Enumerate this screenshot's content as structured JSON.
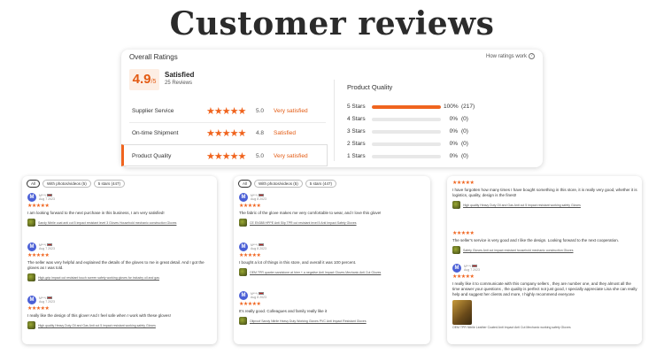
{
  "page_title": "Customer reviews",
  "ratings": {
    "title": "Overall Ratings",
    "how_link": "How ratings work",
    "score": "4.9",
    "score_denominator": "/5",
    "score_word": "Satisfied",
    "review_count": "25 Reviews",
    "subratings": [
      {
        "label": "Supplier Service",
        "score": "5.0",
        "verdict": "Very satisfied",
        "stars": "★★★★★"
      },
      {
        "label": "On-time Shipment",
        "score": "4.8",
        "verdict": "Satisfied",
        "stars": "★★★★★"
      },
      {
        "label": "Product Quality",
        "score": "5.0",
        "verdict": "Very satisfied",
        "stars": "★★★★★"
      }
    ],
    "product_quality_title": "Product Quality",
    "distribution": [
      {
        "label": "5 Stars",
        "percent": 100,
        "percent_label": "100%",
        "count": "(217)"
      },
      {
        "label": "4 Stars",
        "percent": 0,
        "percent_label": "0%",
        "count": "(0)"
      },
      {
        "label": "3 Stars",
        "percent": 0,
        "percent_label": "0%",
        "count": "(0)"
      },
      {
        "label": "2 Stars",
        "percent": 0,
        "percent_label": "0%",
        "count": "(0)"
      },
      {
        "label": "1 Stars",
        "percent": 0,
        "percent_label": "0%",
        "count": "(0)"
      }
    ],
    "accent_color": "#f0641e"
  },
  "panels": [
    {
      "filters": [
        "All",
        "With photos/videos (5)",
        "5 stars (447)"
      ],
      "reviews": [
        {
          "avatar": "M",
          "name": "M***i",
          "date": "Aug 7 2023",
          "stars": "★★★★★",
          "text": "I am looking forward to the next purchase in this business, I am very satisfied!",
          "product": "Sandy Nitrile coat anti cut 5 impact resistant level 3 Gloves Household mechanic construction Gloves"
        },
        {
          "avatar": "M",
          "name": "M***i",
          "date": "Aug 7 2023",
          "stars": "★★★★★",
          "text": "The seller was very helpful and explained the details of the gloves to me in great detail. And I got the gloves as I was told.",
          "product": "High-grip impact cut resistant touch screen safety working gloves for industry oil and gas"
        },
        {
          "avatar": "M",
          "name": "M***i",
          "date": "Aug 7 2023",
          "stars": "★★★★★",
          "text": "I really like the design of this glove! And I feel safe when I work with these gloves!",
          "product": "High quality Heavy Duty Oil and Gas Anti cut 5 impact resistant working safety Gloves"
        }
      ]
    },
    {
      "filters": [
        "All",
        "With photos/videos (5)",
        "5 stars (447)"
      ],
      "reviews": [
        {
          "avatar": "M",
          "name": "M***i",
          "date": "Aug 8 2023",
          "stars": "★★★★★",
          "text": "The fabric of the glove makes me very comfortable to wear, and I love this glove!",
          "product": "CE EN388 HPPE Anti Slip TPR cut resistant level 5 Anti Impact Safety Gloves"
        },
        {
          "avatar": "M",
          "name": "M***i",
          "date": "Aug 8 2023",
          "stars": "★★★★★",
          "text": "I bought a lot of things in this store, and overall it was 100 percent.",
          "product": "OEM TPR quarter sandstone at hirer + a negative Anti Impact Gloves Mechanic Anti Cut Gloves"
        },
        {
          "avatar": "M",
          "name": "M***i",
          "date": "Aug 8 2023",
          "stars": "★★★★★",
          "text": "It's really good. Colleagues and family really like it",
          "product": "Oilproof Sandy Nitrile Heavy Duty Working Gloves PVC Anti Impact Resistant Gloves"
        }
      ]
    },
    {
      "reviews": [
        {
          "avatar": "",
          "name": "",
          "date": "",
          "stars": "★★★★★",
          "text": "I have forgotten how many times I have bought something in this store, it is really very good, whether it is logistics, quality, design is the finest!",
          "product": "High quality Heavy Duty Oil and Gas Anti cut 5 impact resistant working safety Gloves"
        },
        {
          "avatar": "",
          "name": "",
          "date": "",
          "stars": "★★★★★",
          "text": "The seller's service is very good and I like the design. Looking forward to the next cooperation.",
          "product": "Safety Gloves Anti cut impact resistant household mechanic construction Gloves"
        },
        {
          "avatar": "M",
          "name": "M***i",
          "date": "Aug 7 2023",
          "stars": "★★★★★",
          "text": "I really like it to communicate with this company sellers , they are number one, and they almost all the time answer your questions , the quality is perfect not just good, I specially appreciate Lisa she can really help and suggest her clients and more, I highly recommend everyone",
          "product": "OEM TPR Nitrile Leather Coated Anti Impact Anti Cut Mechanic working safety Gloves"
        }
      ]
    }
  ]
}
